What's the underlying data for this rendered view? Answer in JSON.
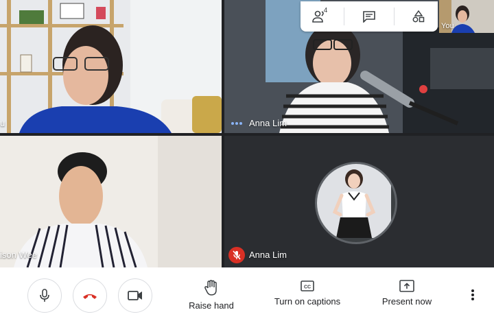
{
  "participants": [
    {
      "name": "u"
    },
    {
      "name": "Anna Lim"
    },
    {
      "name": "ison Wee"
    },
    {
      "name": "Anna Lim"
    }
  ],
  "self_view": {
    "label": "You"
  },
  "top_panel": {
    "people_count": "4",
    "icons": [
      "people-icon",
      "chat-icon",
      "activities-icon"
    ]
  },
  "controls": {
    "raise_hand": "Raise hand",
    "captions": "Turn on captions",
    "present": "Present now"
  },
  "colors": {
    "hangup": "#d93025",
    "muted_badge": "#d93025",
    "speaking_dots": "#8ab4f8"
  }
}
